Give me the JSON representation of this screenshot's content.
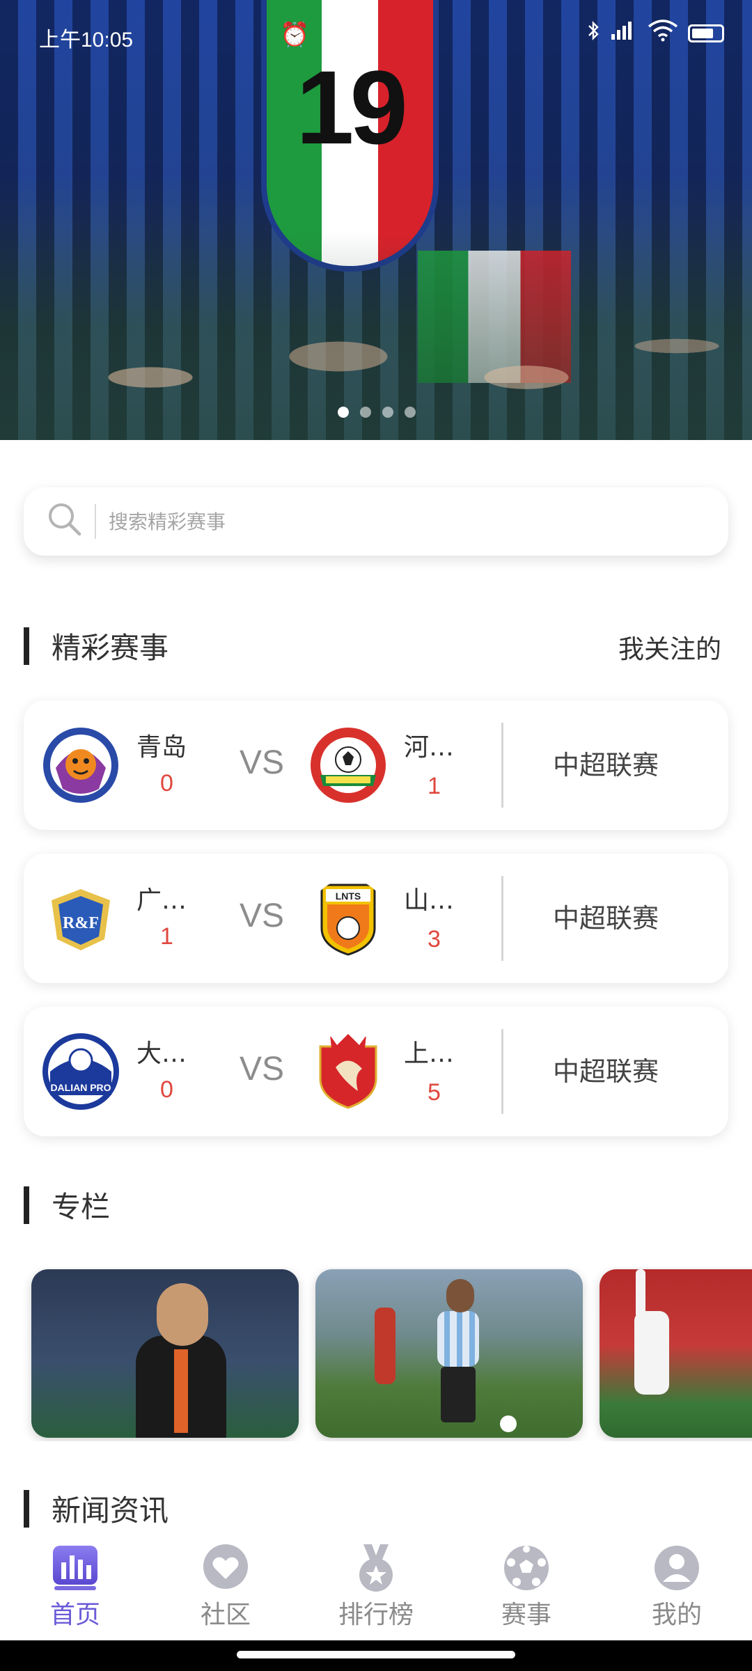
{
  "status_bar": {
    "time": "上午10:05",
    "alarm_icon": "alarm-icon",
    "icons": [
      "bluetooth-icon",
      "signal-icon",
      "wifi-icon",
      "battery-icon"
    ]
  },
  "banner": {
    "jersey_number": "19",
    "slides_total": 4,
    "slide_active_index": 0
  },
  "search": {
    "placeholder": "搜索精彩赛事",
    "icon": "search-icon"
  },
  "matches_section": {
    "title": "精彩赛事",
    "link_label": "我关注的",
    "vs_label": "VS",
    "items": [
      {
        "home_name": "青岛",
        "home_score": "0",
        "away_name": "河…",
        "away_score": "1",
        "league": "中超联赛"
      },
      {
        "home_name": "广…",
        "home_score": "1",
        "away_name": "山…",
        "away_score": "3",
        "league": "中超联赛"
      },
      {
        "home_name": "大…",
        "home_score": "0",
        "away_name": "上…",
        "away_score": "5",
        "league": "中超联赛"
      }
    ]
  },
  "column_section": {
    "title": "专栏"
  },
  "news_section": {
    "title": "新闻资讯"
  },
  "bottom_nav": {
    "items": [
      {
        "label": "首页",
        "icon": "chart-bars-icon",
        "active": true
      },
      {
        "label": "社区",
        "icon": "heart-bubble-icon",
        "active": false
      },
      {
        "label": "排行榜",
        "icon": "medal-icon",
        "active": false
      },
      {
        "label": "赛事",
        "icon": "soccer-ball-icon",
        "active": false
      },
      {
        "label": "我的",
        "icon": "user-icon",
        "active": false
      }
    ]
  },
  "colors": {
    "accent": "#6a5bd8",
    "score_red": "#e0483e",
    "nav_gray": "#b9b9c4"
  }
}
